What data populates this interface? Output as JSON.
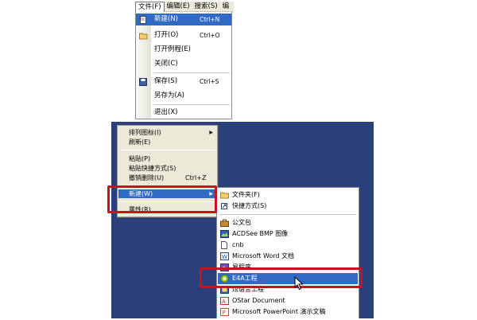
{
  "file_menu": {
    "menubar": [
      "文件(F)",
      "编辑(E)",
      "搜索(S)",
      "编"
    ],
    "items": [
      {
        "label": "新建(N)",
        "shortcut": "Ctrl+N",
        "icon": "new-file-icon"
      },
      {
        "label": "打开(O)",
        "shortcut": "Ctrl+O",
        "icon": "open-folder-icon"
      },
      {
        "label": "打开例程(E)",
        "shortcut": ""
      },
      {
        "label": "关闭(C)",
        "shortcut": ""
      },
      {
        "label": "保存(S)",
        "shortcut": "Ctrl+S",
        "icon": "save-disk-icon"
      },
      {
        "label": "另存为(A)",
        "shortcut": ""
      },
      {
        "label": "退出(X)",
        "shortcut": ""
      }
    ]
  },
  "context_menu": {
    "items": [
      {
        "label": "排列图标(I)",
        "has_submenu": true
      },
      {
        "label": "刷新(E)"
      },
      {
        "label": "粘贴(P)"
      },
      {
        "label": "粘贴快捷方式(S)"
      },
      {
        "label": "撤销删除(U)",
        "shortcut": "Ctrl+Z"
      },
      {
        "label": "新建(W)",
        "has_submenu": true
      },
      {
        "label": "属性(R)"
      }
    ]
  },
  "new_submenu": {
    "items": [
      {
        "label": "文件夹(F)",
        "icon": "folder-icon"
      },
      {
        "label": "快捷方式(S)",
        "icon": "shortcut-icon"
      },
      {
        "label": "公文包",
        "icon": "briefcase-icon"
      },
      {
        "label": "ACDSee BMP 图像",
        "icon": "bmp-image-icon"
      },
      {
        "label": "cnb",
        "icon": "blank-file-icon"
      },
      {
        "label": "Microsoft Word 文档",
        "icon": "word-doc-icon"
      },
      {
        "label": "易程序",
        "icon": "e-program-icon"
      },
      {
        "label": "E4A工程",
        "icon": "e4a-project-icon"
      },
      {
        "label": "炫语言工程",
        "icon": "project-icon"
      },
      {
        "label": "OStar Document",
        "icon": "ostar-doc-icon"
      },
      {
        "label": "Microsoft PowerPoint 演示文稿",
        "icon": "ppt-icon"
      }
    ]
  },
  "colors": {
    "highlight": "#316ac5",
    "desktop": "#2b3f7a",
    "annotation_box": "#c8121e"
  }
}
